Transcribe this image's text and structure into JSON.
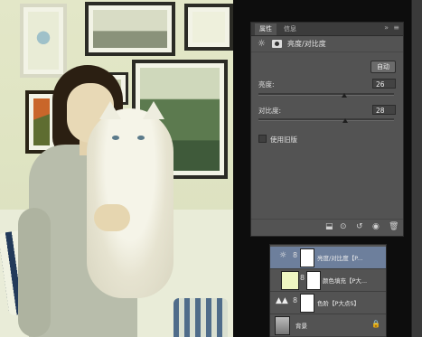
{
  "properties_panel": {
    "tabs": [
      "属性",
      "信息"
    ],
    "adjustment_title": "亮度/对比度",
    "auto_button": "自动",
    "brightness": {
      "label": "亮度:",
      "value": "26",
      "level_pct": 63
    },
    "contrast": {
      "label": "对比度:",
      "value": "28",
      "level_pct": 64
    },
    "legacy_checkbox": {
      "label": "使用旧版",
      "checked": false
    }
  },
  "layers_panel": {
    "layers": [
      {
        "name": "亮度/对比度【P...",
        "selected": true
      },
      {
        "name": "颜色填充【P大...",
        "selected": false
      },
      {
        "name": "色阶【P大点S】",
        "selected": false
      },
      {
        "name": "背景",
        "selected": false
      }
    ]
  },
  "icons": {
    "panel_menu": "menu-icon",
    "collapse": "double-chevron-icon",
    "adjustment": "sun-icon",
    "mask": "mask-icon",
    "lock": "lock-icon"
  },
  "colors": {
    "panel_bg": "#535353",
    "selected_layer": "#6d7f9c"
  }
}
